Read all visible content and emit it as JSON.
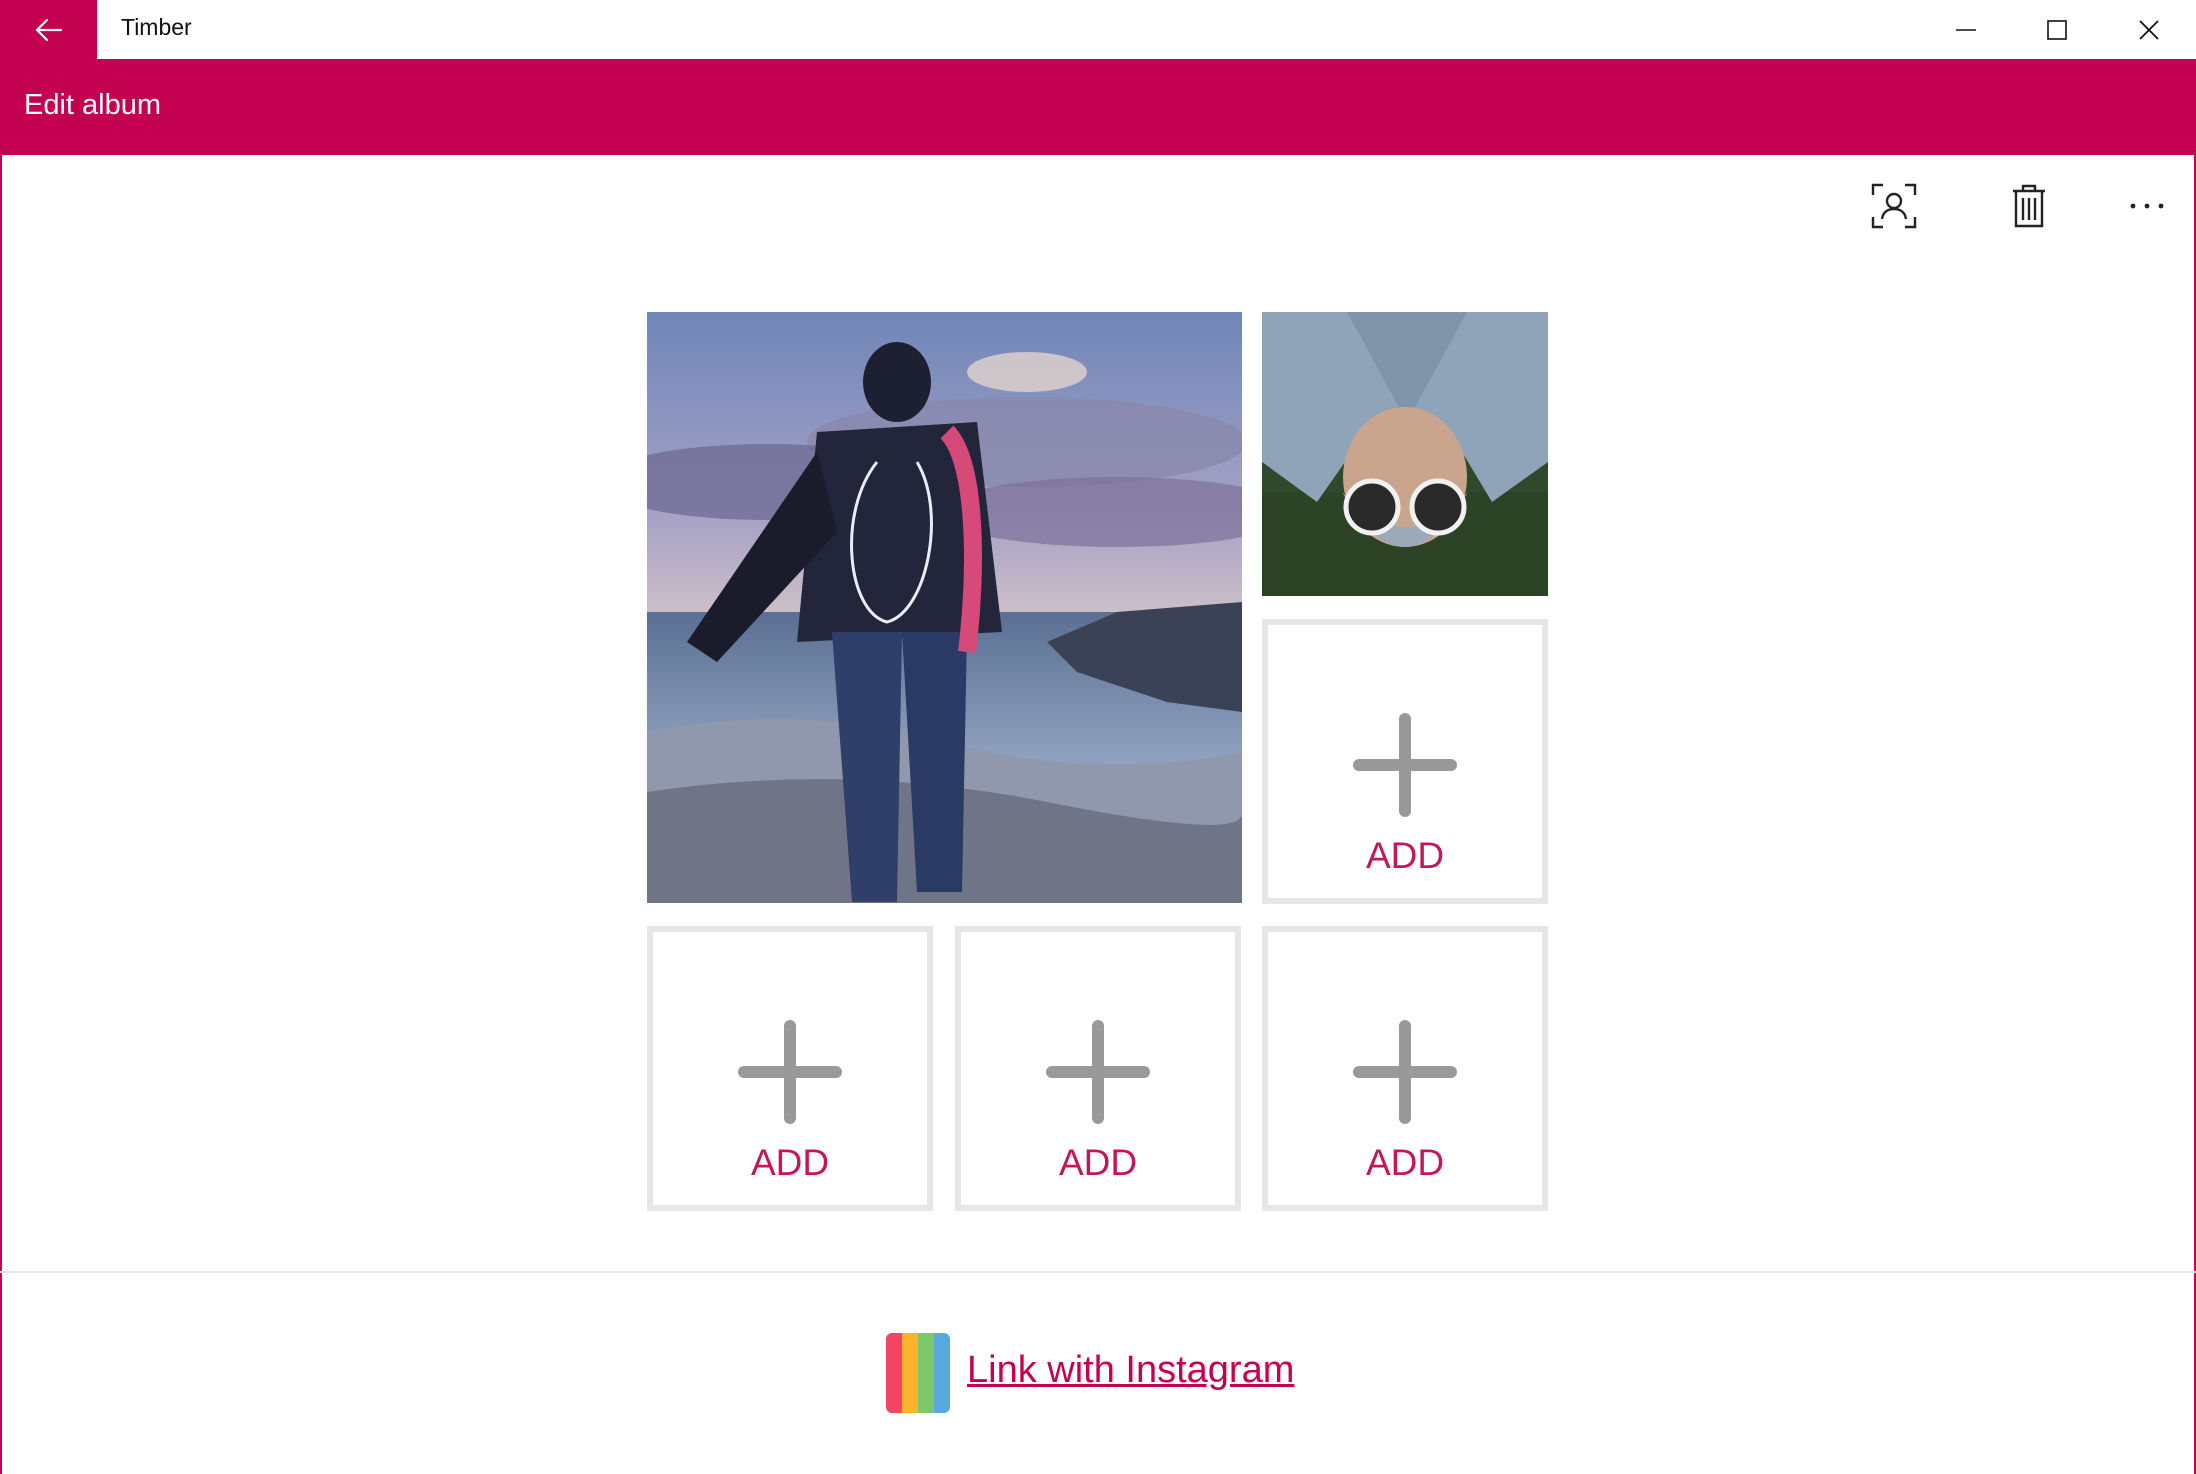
{
  "window": {
    "title": "Timber"
  },
  "header": {
    "title": "Edit album"
  },
  "toolbar": {
    "more_label": "···"
  },
  "grid": {
    "add_slots": [
      {
        "label": "ADD"
      },
      {
        "label": "ADD"
      },
      {
        "label": "ADD"
      },
      {
        "label": "ADD"
      }
    ]
  },
  "footer": {
    "link_label": "Link with Instagram"
  },
  "colors": {
    "accent": "#c40051",
    "add_label": "#c2185b",
    "slot_border": "#e6e6e6",
    "plus": "#999999"
  },
  "icons": {
    "back": "arrow-left-icon",
    "minimize": "minimize-icon",
    "maximize": "maximize-icon",
    "close": "close-icon",
    "face_scan": "face-scan-icon",
    "trash": "trash-icon",
    "more": "more-icon",
    "plus": "plus-icon",
    "instagram": "instagram-logo-icon"
  }
}
